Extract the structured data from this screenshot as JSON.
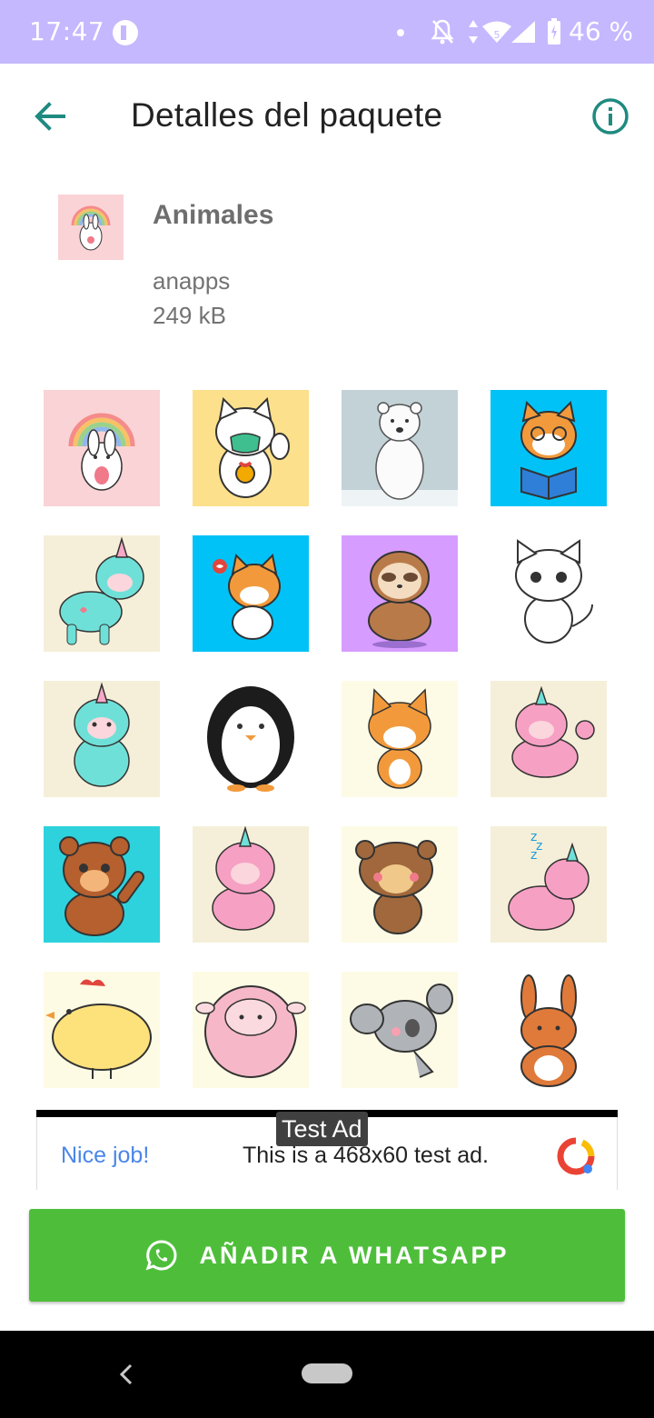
{
  "status_bar": {
    "time": "17:47",
    "battery_percent": "46 %",
    "background_color": "#c5b8ff",
    "icons": [
      "privacy-icon",
      "notification-dot-icon",
      "bell-off-icon",
      "data-arrows-icon",
      "wifi-icon",
      "cell-signal-icon",
      "battery-icon"
    ]
  },
  "app_bar": {
    "title": "Detalles del paquete",
    "back_icon": "arrow-left-icon",
    "info_icon": "info-circle-icon",
    "accent_color": "#1f8a80"
  },
  "pack": {
    "name": "Animales",
    "publisher": "anapps",
    "size": "249 kB",
    "tray_icon": "rainbow-bunny"
  },
  "stickers": [
    {
      "subject": "rainbow-bunny",
      "bg": "#fad3d6"
    },
    {
      "subject": "lucky-cat-mask",
      "bg": "#fde08c"
    },
    {
      "subject": "polar-bear",
      "bg": "#c3d2d6"
    },
    {
      "subject": "shiba-reading",
      "bg": "#00c2f7"
    },
    {
      "subject": "teal-llama-unicorn",
      "bg": "#f5efd9"
    },
    {
      "subject": "shiba-heart",
      "bg": "#00c2f7"
    },
    {
      "subject": "sloth-meditating",
      "bg": "#d79cff"
    },
    {
      "subject": "white-kitten",
      "bg": "#ffffff"
    },
    {
      "subject": "teal-llama-unicorn-2",
      "bg": "#f5efd9"
    },
    {
      "subject": "penguin",
      "bg": "#ffffff"
    },
    {
      "subject": "fox",
      "bg": "#fdfbe6"
    },
    {
      "subject": "pink-llama-unicorn",
      "bg": "#f5efd9"
    },
    {
      "subject": "brown-bear-waving",
      "bg": "#2ed2dc"
    },
    {
      "subject": "pink-llama-unicorn-2",
      "bg": "#f5efd9"
    },
    {
      "subject": "brown-bear-dancing",
      "bg": "#fdfbe6"
    },
    {
      "subject": "pink-llama-sleeping",
      "bg": "#f5efd9"
    },
    {
      "subject": "yellow-chick",
      "bg": "#fefbe4"
    },
    {
      "subject": "pink-sheep",
      "bg": "#fefbe4"
    },
    {
      "subject": "koala",
      "bg": "#fdfbe6"
    },
    {
      "subject": "orange-bunny",
      "bg": "#ffffff"
    }
  ],
  "ad": {
    "label": "Test Ad",
    "headline": "Nice job!",
    "body": "This is a 468x60 test ad."
  },
  "add_button": {
    "label": "AÑADIR A WHATSAPP",
    "icon": "whatsapp-icon",
    "color": "#4ebe3a"
  },
  "nav_bar": {
    "icons": [
      "nav-back-icon",
      "nav-home-pill"
    ]
  }
}
